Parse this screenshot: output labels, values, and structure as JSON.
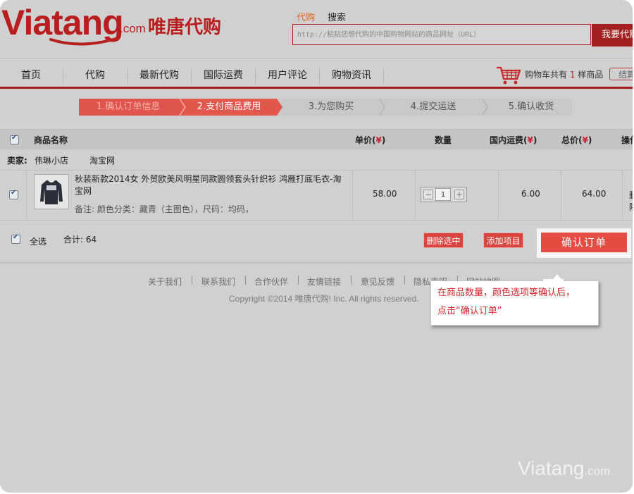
{
  "brand": {
    "logo_text": "Viatang",
    "logo_com": ".com",
    "logo_cn": "唯唐代购",
    "watermark_main": "Viatang",
    "watermark_com": ".com"
  },
  "search": {
    "tabs": [
      "代购",
      "搜索"
    ],
    "placeholder": "http://粘贴您想代购的中国购物网站的商品网址（URL）",
    "button_label": "我要代购"
  },
  "nav": {
    "items": [
      "首页",
      "代购",
      "最新代购",
      "国际运费",
      "用户评论",
      "购物资讯"
    ],
    "cart_prefix": "购物车共有 ",
    "cart_count": "1",
    "cart_suffix": " 样商品",
    "checkout_label": "结算"
  },
  "steps": [
    "1.确认订单信息",
    "2.支付商品费用",
    "3.为您购买",
    "4.提交运送",
    "5.确认收货"
  ],
  "table": {
    "headers": {
      "product": "商品名称",
      "unit_price": "单价(",
      "quantity": "数量",
      "shipping": "国内运费(",
      "total": "总价(",
      "ops": "操作",
      "currency": "¥",
      "close": ")"
    },
    "seller_label": "卖家:",
    "seller_name": "伟琳小店",
    "seller_platform": "淘宝网",
    "row": {
      "name": "秋装新款2014女 外贸欧美风明星同款圆领套头针织衫 鸿雁打底毛衣-淘宝网",
      "note": "备注: 颜色分类：藏青（主图色），尺码：均码，",
      "unit_price": "58.00",
      "quantity": "1",
      "shipping": "6.00",
      "total": "64.00",
      "op_label": "删除"
    },
    "select_all_label": "全选",
    "total_label": "合计: 64",
    "delete_selected_label": "删除选中",
    "add_item_label": "添加项目",
    "confirm_label": "确认订单"
  },
  "footer": {
    "links": [
      "关于我们",
      "联系我们",
      "合作伙伴",
      "友情链接",
      "意见反馈",
      "隐私声明",
      "网站地图"
    ],
    "copyright": "Copyright ©2014 唯唐代购! Inc. All rights reserved."
  },
  "callout": {
    "line1": "在商品数量，颜色选项等确认后，",
    "line2": "点击“确认订单”"
  },
  "colors": {
    "brand_red": "#b81e1e",
    "step_active": "#e0544d",
    "button_red": "#d9443e",
    "callout_text": "#d8252a"
  }
}
